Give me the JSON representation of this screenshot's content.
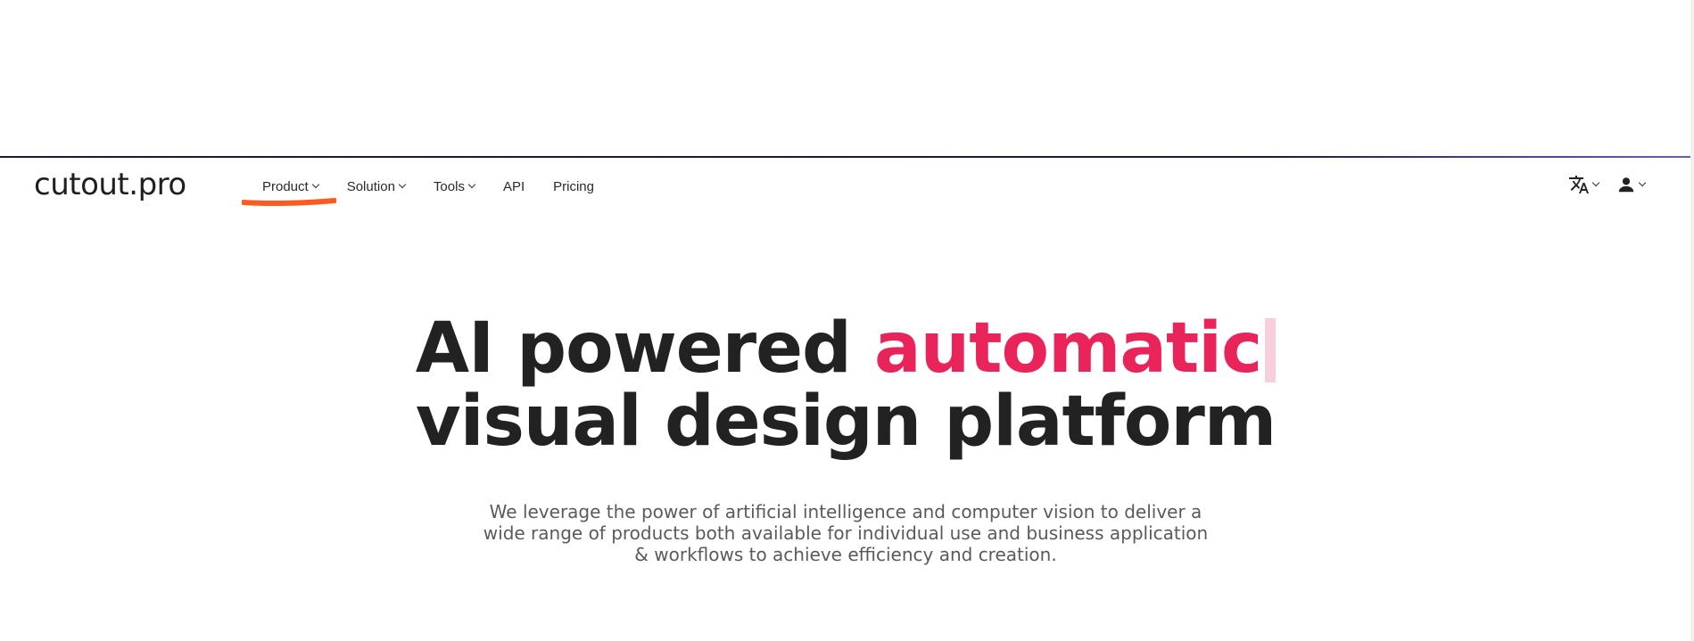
{
  "brand": {
    "logo_text": "cutout.pro"
  },
  "nav": {
    "items": [
      {
        "label": "Product",
        "has_dropdown": true,
        "active": true
      },
      {
        "label": "Solution",
        "has_dropdown": true
      },
      {
        "label": "Tools",
        "has_dropdown": true
      },
      {
        "label": "API",
        "has_dropdown": false
      },
      {
        "label": "Pricing",
        "has_dropdown": false
      }
    ],
    "right": {
      "language_icon": "translate-icon",
      "account_icon": "user-icon"
    }
  },
  "hero": {
    "title_part1": "AI powered ",
    "title_accent": "automatic",
    "title_line2": "visual design platform",
    "subtitle": "We leverage the power of artificial intelligence and computer vision to deliver a wide range of products both available for individual use and business application & workflows to achieve efficiency and creation."
  },
  "colors": {
    "accent": "#e8245a",
    "underline_mark": "#ff5a1f",
    "text_dark": "#222222",
    "text_muted": "#5a5a5a"
  }
}
